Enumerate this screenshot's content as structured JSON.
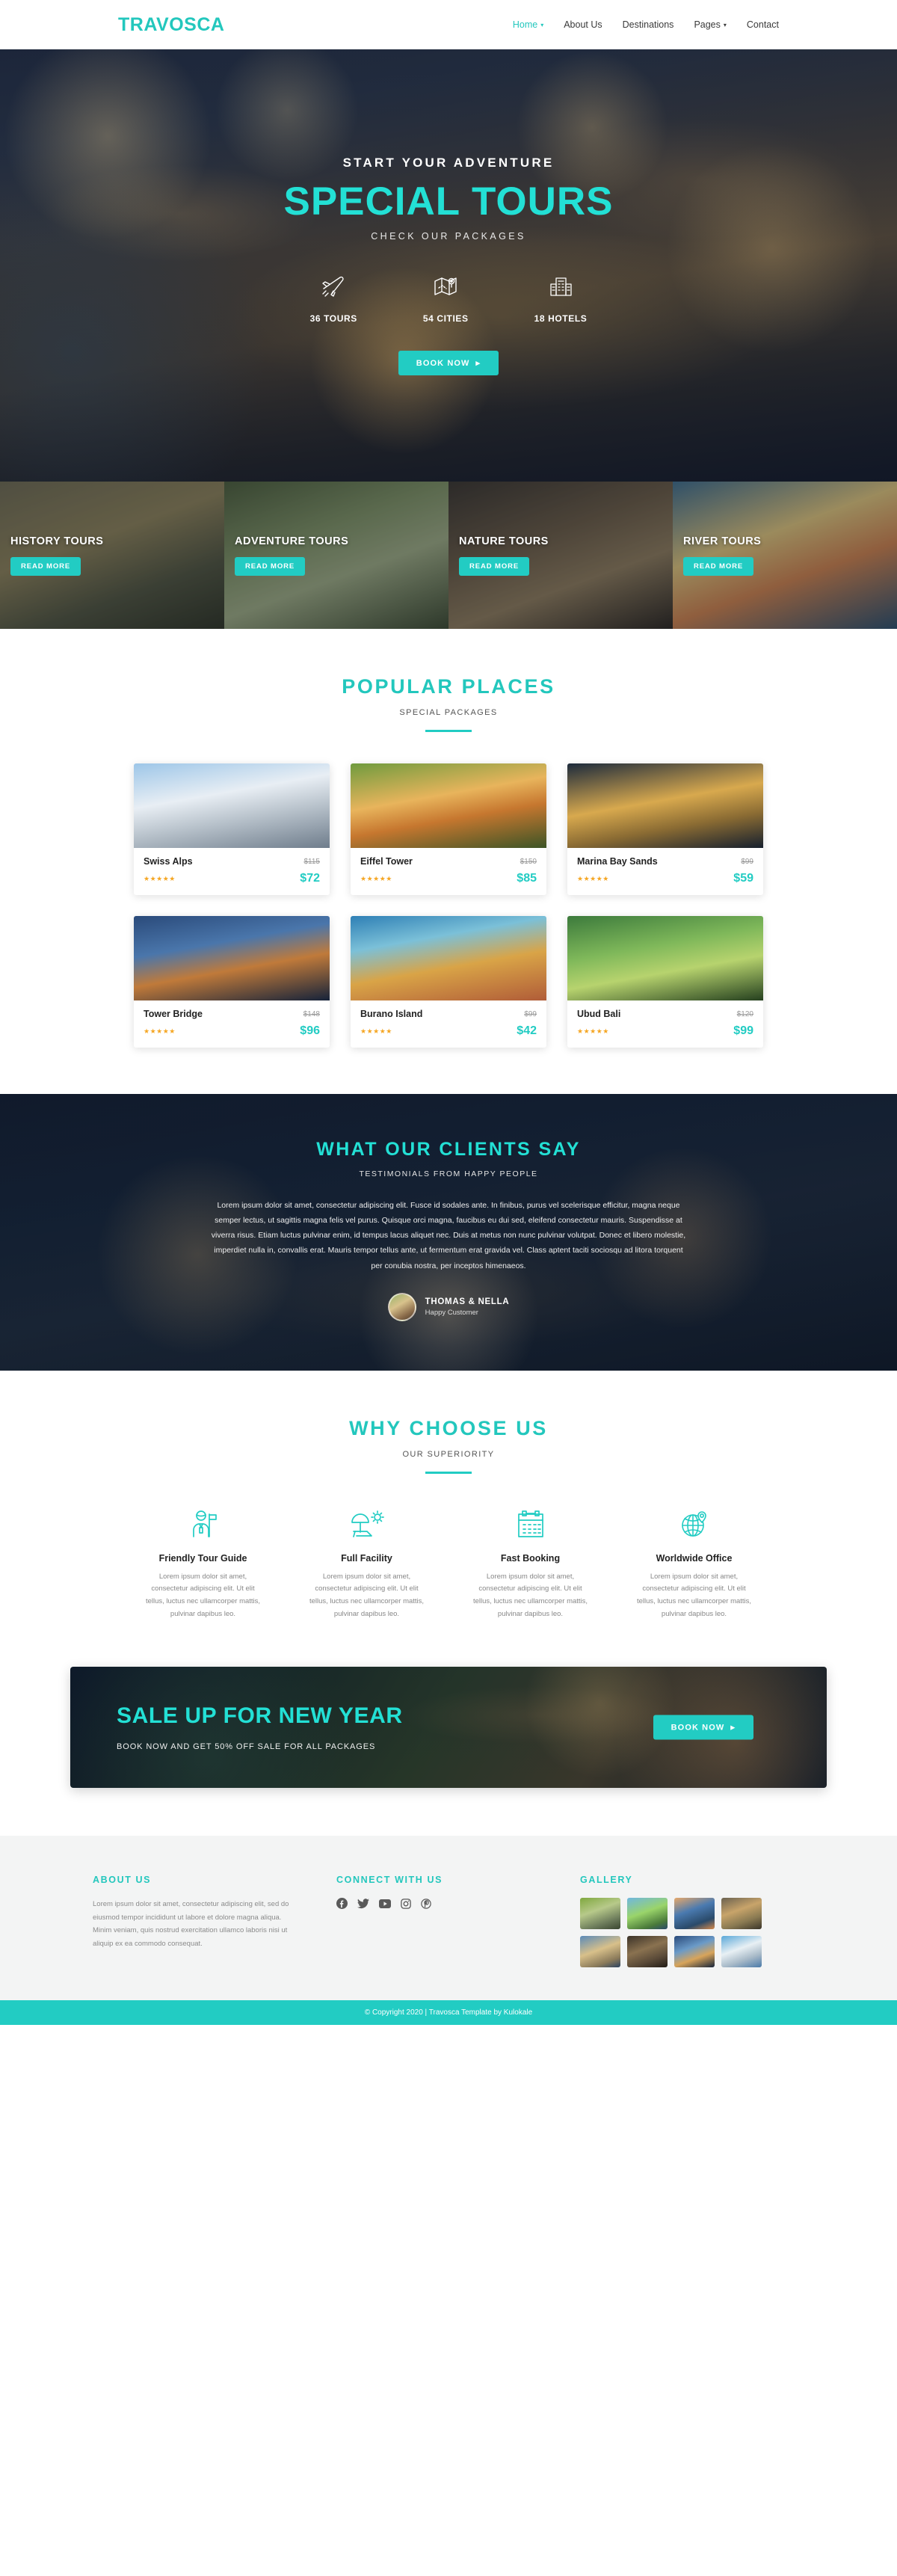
{
  "brand": "TRAVOSCA",
  "nav": {
    "items": [
      {
        "label": "Home",
        "caret": "▾",
        "active": true
      },
      {
        "label": "About Us",
        "caret": "",
        "active": false
      },
      {
        "label": "Destinations",
        "caret": "",
        "active": false
      },
      {
        "label": "Pages",
        "caret": "▾",
        "active": false
      },
      {
        "label": "Contact",
        "caret": "",
        "active": false
      }
    ]
  },
  "hero": {
    "eyebrow": "START YOUR ADVENTURE",
    "title": "SPECIAL TOURS",
    "subtitle": "CHECK OUR PACKAGES",
    "stats": [
      {
        "icon": "plane-icon",
        "label": "36 TOURS"
      },
      {
        "icon": "map-pin-icon",
        "label": "54 CITIES"
      },
      {
        "icon": "hotel-icon",
        "label": "18 HOTELS"
      }
    ],
    "cta": "BOOK NOW",
    "cta_arrow": "▸"
  },
  "categories": [
    {
      "title": "HISTORY TOURS",
      "button": "READ MORE"
    },
    {
      "title": "ADVENTURE TOURS",
      "button": "READ MORE"
    },
    {
      "title": "NATURE TOURS",
      "button": "READ MORE"
    },
    {
      "title": "RIVER TOURS",
      "button": "READ MORE"
    }
  ],
  "popular": {
    "title": "POPULAR PLACES",
    "subtitle": "SPECIAL PACKAGES",
    "places": [
      {
        "name": "Swiss Alps",
        "old_price": "$115",
        "new_price": "$72",
        "stars": "★★★★★"
      },
      {
        "name": "Eiffel Tower",
        "old_price": "$150",
        "new_price": "$85",
        "stars": "★★★★★"
      },
      {
        "name": "Marina Bay Sands",
        "old_price": "$99",
        "new_price": "$59",
        "stars": "★★★★★"
      },
      {
        "name": "Tower Bridge",
        "old_price": "$148",
        "new_price": "$96",
        "stars": "★★★★★"
      },
      {
        "name": "Burano Island",
        "old_price": "$99",
        "new_price": "$42",
        "stars": "★★★★★"
      },
      {
        "name": "Ubud Bali",
        "old_price": "$120",
        "new_price": "$99",
        "stars": "★★★★★"
      }
    ]
  },
  "testimonial": {
    "title": "WHAT OUR CLIENTS SAY",
    "subtitle": "TESTIMONIALS FROM HAPPY PEOPLE",
    "quote": "Lorem ipsum dolor sit amet, consectetur adipiscing elit. Fusce id sodales ante. In finibus, purus vel scelerisque efficitur, magna neque semper lectus, ut sagittis magna felis vel purus. Quisque orci magna, faucibus eu dui sed, eleifend consectetur mauris. Suspendisse at viverra risus. Etiam luctus pulvinar enim, id tempus lacus aliquet nec. Duis at metus non nunc pulvinar volutpat. Donec et libero molestie, imperdiet nulla in, convallis erat. Mauris tempor tellus ante, ut fermentum erat gravida vel. Class aptent taciti sociosqu ad litora torquent per conubia nostra, per inceptos himenaeos.",
    "author_name": "THOMAS & NELLA",
    "author_role": "Happy Customer"
  },
  "why": {
    "title": "WHY CHOOSE US",
    "subtitle": "OUR SUPERIORITY",
    "features": [
      {
        "icon": "tour-guide-icon",
        "title": "Friendly Tour Guide",
        "text": "Lorem ipsum dolor sit amet, consectetur adipiscing elit. Ut elit tellus, luctus nec ullamcorper mattis, pulvinar dapibus leo."
      },
      {
        "icon": "beach-umbrella-icon",
        "title": "Full Facility",
        "text": "Lorem ipsum dolor sit amet, consectetur adipiscing elit. Ut elit tellus, luctus nec ullamcorper mattis, pulvinar dapibus leo."
      },
      {
        "icon": "calendar-icon",
        "title": "Fast Booking",
        "text": "Lorem ipsum dolor sit amet, consectetur adipiscing elit. Ut elit tellus, luctus nec ullamcorper mattis, pulvinar dapibus leo."
      },
      {
        "icon": "globe-pin-icon",
        "title": "Worldwide Office",
        "text": "Lorem ipsum dolor sit amet, consectetur adipiscing elit. Ut elit tellus, luctus nec ullamcorper mattis, pulvinar dapibus leo."
      }
    ]
  },
  "sale": {
    "title": "SALE UP FOR NEW YEAR",
    "subtitle": "BOOK NOW AND GET 50% OFF SALE FOR ALL PACKAGES",
    "cta": "BOOK NOW",
    "cta_arrow": "▸"
  },
  "footer": {
    "about_title": "ABOUT US",
    "about_text": "Lorem ipsum dolor sit amet, consectetur adipiscing elit, sed do eiusmod tempor incididunt ut labore et dolore magna aliqua. Minim veniam, quis nostrud exercitation ullamco laboris nisi ut aliquip ex ea commodo consequat.",
    "connect_title": "CONNECT WITH US",
    "socials": [
      "facebook-icon",
      "twitter-icon",
      "youtube-icon",
      "instagram-icon",
      "pinterest-icon"
    ],
    "gallery_title": "GALLERY",
    "gallery_count": 8,
    "copyright": "© Copyright 2020 | Travosca Template by Kulokale"
  },
  "colors": {
    "accent": "#22ccc3",
    "accent_bright": "#23e0d5",
    "star": "#f5a623"
  }
}
